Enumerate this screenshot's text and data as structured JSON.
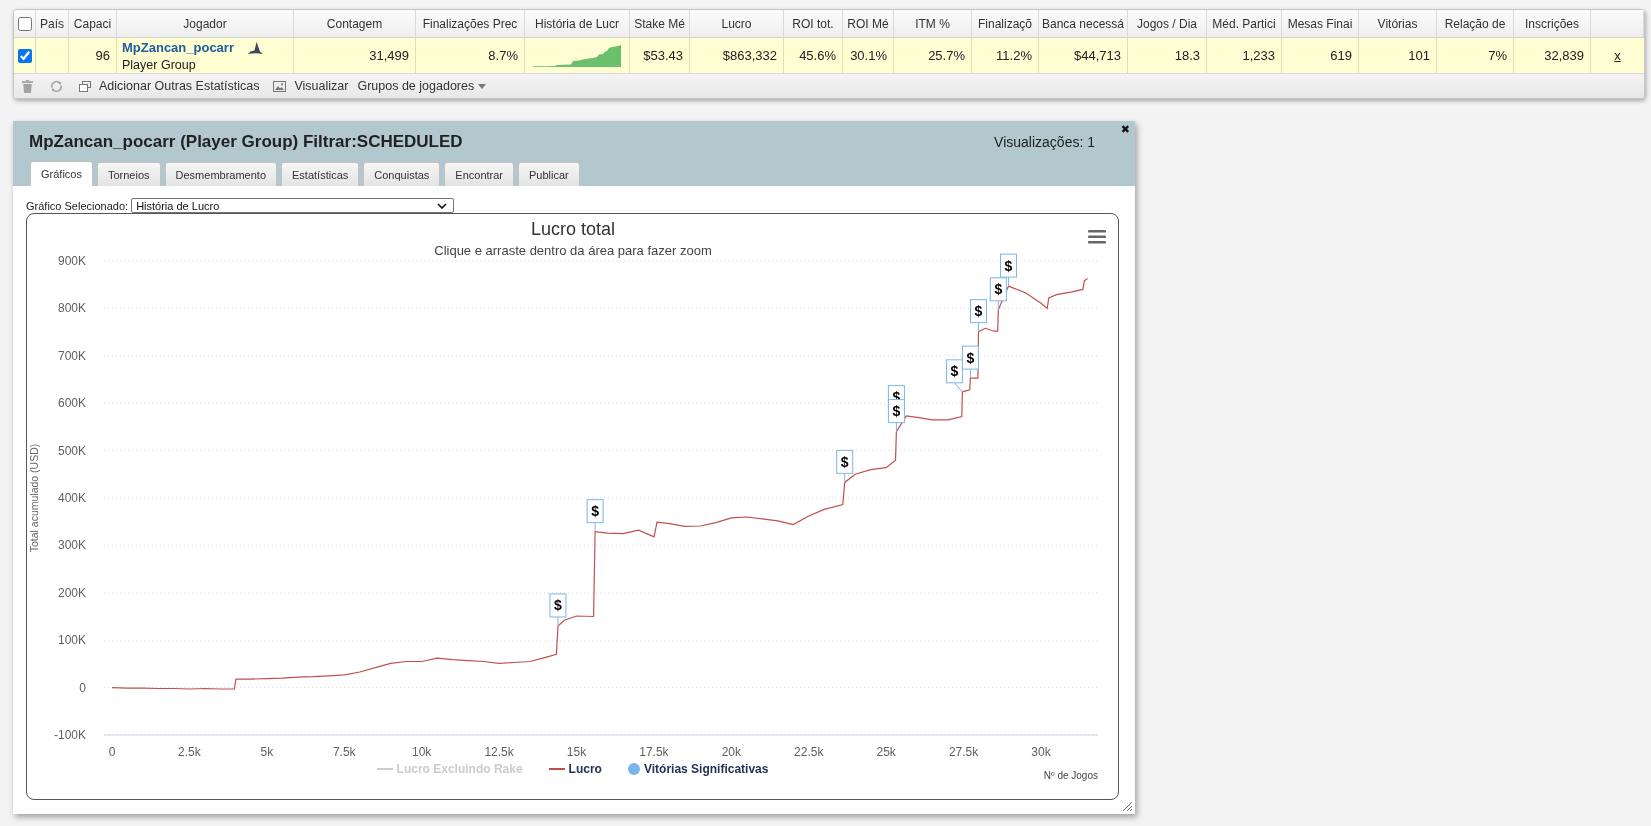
{
  "players_table": {
    "select_all": {
      "checked": false
    },
    "columns": [
      "País",
      "Capaci",
      "Jogador",
      "Contagem",
      "Finalizações Prec",
      "História de Lucr",
      "Stake Mé",
      "Lucro",
      "ROI tot.",
      "ROI Mé",
      "ITM %",
      "Finalizaçõ",
      "Banca necessá",
      "Jogos / Dia",
      "Méd. Partici",
      "Mesas Finai",
      "Vitórias",
      "Relação de",
      "Inscrições"
    ],
    "rows": [
      {
        "checked": true,
        "cells": [
          {
            "kind": "empty"
          },
          {
            "kind": "number",
            "text": "96"
          },
          {
            "kind": "player",
            "name": "MpZancan_pocarr",
            "group": "Player Group"
          },
          {
            "kind": "number",
            "text": "31,499"
          },
          {
            "kind": "number",
            "text": "8.7%"
          },
          {
            "kind": "sparkline"
          },
          {
            "kind": "number",
            "text": "$53.43"
          },
          {
            "kind": "number",
            "text": "$863,332"
          },
          {
            "kind": "number",
            "text": "45.6%"
          },
          {
            "kind": "number",
            "text": "30.1%"
          },
          {
            "kind": "number",
            "text": "25.7%"
          },
          {
            "kind": "number",
            "text": "11.2%"
          },
          {
            "kind": "number",
            "text": "$44,713"
          },
          {
            "kind": "number",
            "text": "18.3"
          },
          {
            "kind": "number",
            "text": "1,233"
          },
          {
            "kind": "number",
            "text": "619"
          },
          {
            "kind": "number",
            "text": "101"
          },
          {
            "kind": "number",
            "text": "7%"
          },
          {
            "kind": "number",
            "text": "32,839"
          }
        ],
        "remove": "x"
      }
    ],
    "toolbar": {
      "add_stats": "Adicionar Outras Estatísticas",
      "visualize": "Visualizar",
      "groups_menu": "Grupos de jogadores"
    }
  },
  "panel": {
    "title": "MpZancan_pocarr (Player Group) Filtrar:SCHEDULED",
    "views": "Visualizações: 1",
    "close": "✖",
    "tabs": [
      {
        "label": "Gráficos",
        "selected": true
      },
      {
        "label": "Torneios",
        "selected": false
      },
      {
        "label": "Desmembramento",
        "selected": false
      },
      {
        "label": "Estatísticas",
        "selected": false
      },
      {
        "label": "Conquistas",
        "selected": false
      },
      {
        "label": "Encontrar",
        "selected": false
      },
      {
        "label": "Publicar",
        "selected": false
      }
    ],
    "chart_selector": {
      "label": "Gráfico Selecionado:",
      "value": "História de Lucro"
    },
    "chart": {
      "subtitle": "Clique e arraste dentro da área para fazer zoom",
      "series_style": [
        {
          "kind": "line",
          "enabled": false
        },
        {
          "kind": "line",
          "enabled": true
        }
      ],
      "flags_legend": {
        "label": "Vitórias Significativas",
        "color": "#7cb5ec",
        "enabled": true
      },
      "chart_data": {
        "type": "line",
        "title": "Lucro total",
        "xlabel": "Nº de Jogos",
        "ylabel": "Total acumulado (USD)",
        "grid": true,
        "x": [
          0,
          500,
          1000,
          1500,
          2000,
          2500,
          3000,
          3500,
          3950,
          4000,
          4500,
          5000,
          5500,
          6000,
          6500,
          7000,
          7500,
          8000,
          8500,
          9000,
          9500,
          10000,
          10500,
          11000,
          11500,
          12000,
          12500,
          13000,
          13500,
          14000,
          14350,
          14400,
          14600,
          15000,
          15550,
          15600,
          16000,
          16500,
          17000,
          17500,
          17600,
          18000,
          18500,
          19000,
          19500,
          20000,
          20500,
          21000,
          21500,
          22000,
          22500,
          23000,
          23600,
          23660,
          24000,
          24500,
          25000,
          25300,
          25330,
          25650,
          26000,
          26500,
          27000,
          27440,
          27460,
          27700,
          27720,
          27960,
          27980,
          28200,
          28480,
          28600,
          28620,
          28950,
          29500,
          30000,
          30200,
          30250,
          30500,
          31000,
          31350,
          31400,
          31500
        ],
        "series": [
          {
            "name": "Lucro Excluindo Rake",
            "values": [
              null,
              null,
              null,
              null,
              null,
              null,
              null,
              null,
              null,
              null,
              null,
              null,
              null,
              null,
              null,
              null,
              null,
              null,
              null,
              null,
              null,
              null,
              null,
              null,
              null,
              null,
              null,
              null,
              null,
              null,
              null,
              null,
              null,
              null,
              null,
              null,
              null,
              null,
              null,
              null,
              null,
              null,
              null,
              null,
              null,
              null,
              null,
              null,
              null,
              null,
              null,
              null,
              null,
              null,
              null,
              null,
              null,
              null,
              null,
              null,
              null,
              null,
              null,
              null,
              null,
              null,
              null,
              null,
              null,
              null,
              null,
              null,
              null,
              null,
              null,
              null,
              null,
              null,
              null,
              null,
              null,
              null,
              null
            ]
          },
          {
            "name": "Lucro",
            "color": "#c0504d",
            "values": [
              0,
              -1000,
              -1000,
              -2000,
              -2000,
              -3000,
              -2000,
              -3000,
              -3000,
              18000,
              18000,
              19000,
              20000,
              22000,
              23000,
              25000,
              27000,
              33000,
              42000,
              51000,
              55000,
              55000,
              62000,
              59000,
              57000,
              55000,
              51000,
              53000,
              55000,
              64000,
              70000,
              130000,
              142000,
              151000,
              150000,
              329000,
              326000,
              325000,
              332000,
              318000,
              349000,
              346000,
              340000,
              341000,
              348000,
              358000,
              360000,
              356000,
              352000,
              344000,
              362000,
              376000,
              386000,
              433000,
              450000,
              460000,
              464000,
              480000,
              540000,
              573000,
              570000,
              565000,
              565000,
              572000,
              624000,
              628000,
              653000,
              653000,
              751000,
              758000,
              752000,
              752000,
              797000,
              847000,
              833000,
              811000,
              800000,
              822000,
              829000,
              835000,
              840000,
              858000,
              863000
            ]
          }
        ],
        "annotations": [
          {
            "x": 14400,
            "y": 130000,
            "text": "$"
          },
          {
            "x": 15600,
            "y": 329000,
            "text": "$"
          },
          {
            "x": 23660,
            "y": 433000,
            "text": "$"
          },
          {
            "text": "$"
          },
          {
            "x": 25330,
            "y": 540000,
            "text": "$"
          },
          {
            "x": 27460,
            "y": 624000,
            "text": "$"
          },
          {
            "x": 27720,
            "y": 653000,
            "text": "$"
          },
          {
            "x": 27980,
            "y": 751000,
            "text": "$"
          },
          {
            "x": 28620,
            "y": 797000,
            "text": "$"
          },
          {
            "x": 28950,
            "y": 847000,
            "text": "$"
          }
        ],
        "xlim": [
          -260,
          31840
        ],
        "ylim": [
          -100000,
          900000
        ],
        "xticks": [
          {
            "value": 0,
            "label": "0"
          },
          {
            "value": 2500,
            "label": "2.5k"
          },
          {
            "value": 5000,
            "label": "5k"
          },
          {
            "value": 7500,
            "label": "7.5k"
          },
          {
            "value": 10000,
            "label": "10k"
          },
          {
            "value": 12500,
            "label": "12.5k"
          },
          {
            "value": 15000,
            "label": "15k"
          },
          {
            "value": 17500,
            "label": "17.5k"
          },
          {
            "value": 20000,
            "label": "20k"
          },
          {
            "value": 22500,
            "label": "22.5k"
          },
          {
            "value": 25000,
            "label": "25k"
          },
          {
            "value": 27500,
            "label": "27.5k"
          },
          {
            "value": 30000,
            "label": "30k"
          }
        ],
        "yticks": [
          {
            "value": -100000,
            "label": "-100K"
          },
          {
            "value": 0,
            "label": "0"
          },
          {
            "value": 100000,
            "label": "100K"
          },
          {
            "value": 200000,
            "label": "200K"
          },
          {
            "value": 300000,
            "label": "300K"
          },
          {
            "value": 400000,
            "label": "400K"
          },
          {
            "value": 500000,
            "label": "500K"
          },
          {
            "value": 600000,
            "label": "600K"
          },
          {
            "value": 700000,
            "label": "700K"
          },
          {
            "value": 800000,
            "label": "800K"
          },
          {
            "value": 900000,
            "label": "900K"
          }
        ]
      }
    }
  }
}
